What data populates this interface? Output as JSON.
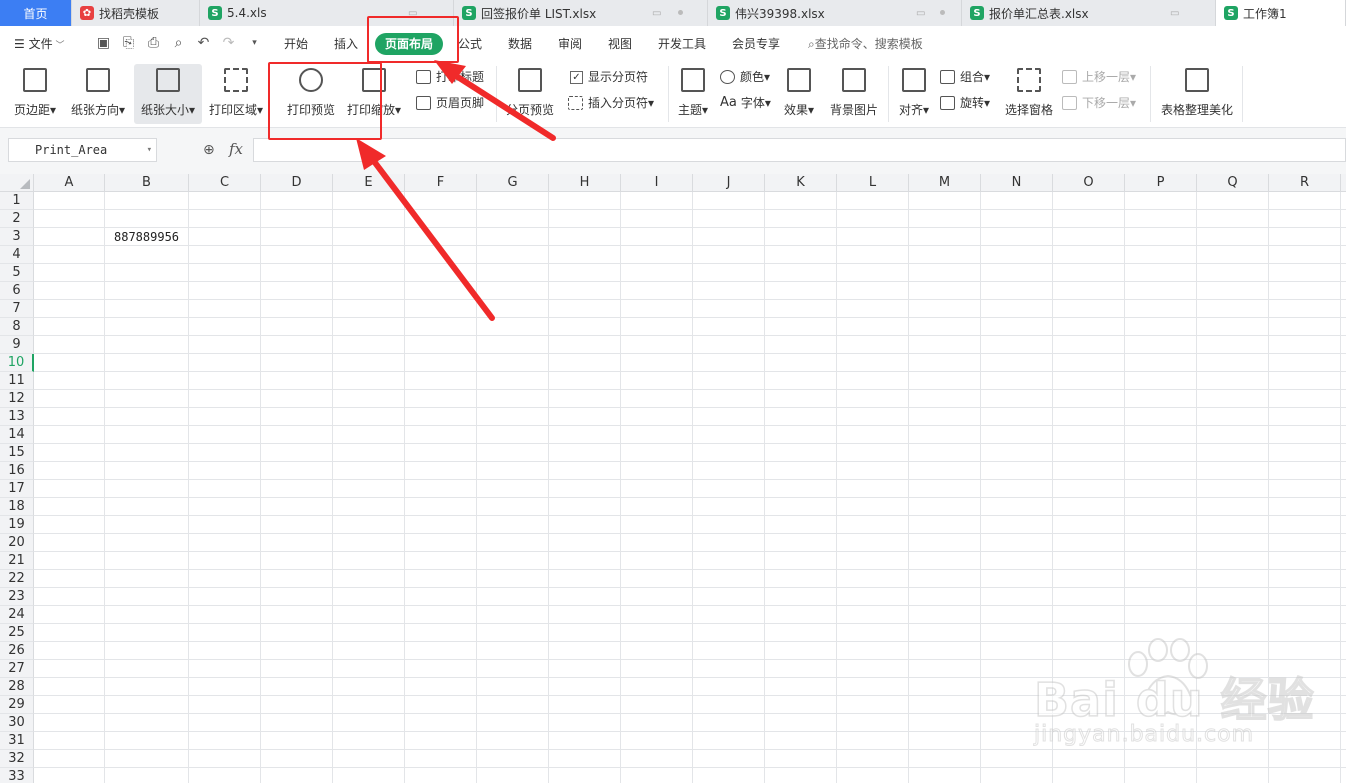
{
  "tabs": [
    {
      "label": "首页",
      "kind": "home"
    },
    {
      "label": "找稻壳模板",
      "kind": "r"
    },
    {
      "label": "5.4.xls",
      "kind": "s"
    },
    {
      "label": "回签报价单 LIST.xlsx",
      "kind": "s"
    },
    {
      "label": "伟兴39398.xlsx",
      "kind": "s"
    },
    {
      "label": "报价单汇总表.xlsx",
      "kind": "s"
    },
    {
      "label": "工作簿1",
      "kind": "s"
    }
  ],
  "file_icon_letter": "S",
  "menu": {
    "file": "文件",
    "items": [
      "开始",
      "插入",
      "页面布局",
      "公式",
      "数据",
      "审阅",
      "视图",
      "开发工具",
      "会员专享"
    ],
    "search": "查找命令、搜索模板"
  },
  "ribbon": {
    "margins": "页边距",
    "orientation": "纸张方向",
    "size": "纸张大小",
    "print_area": "打印区域",
    "print_preview": "打印预览",
    "print_scale": "打印缩放",
    "print_titles": "打印标题",
    "header_footer": "页眉页脚",
    "page_break_preview": "分页预览",
    "show_breaks": "显示分页符",
    "insert_break": "插入分页符",
    "theme": "主题",
    "colors": "颜色",
    "fonts": "字体",
    "fonts_prefix": "Aa",
    "effects": "效果",
    "background": "背景图片",
    "align": "对齐",
    "group": "组合",
    "rotate": "旋转",
    "select_pane": "选择窗格",
    "bring_forward": "上移一层",
    "send_backward": "下移一层",
    "beautify": "表格整理美化"
  },
  "formula_bar": {
    "name_box": "Print_Area",
    "fx": "fx",
    "value": ""
  },
  "columns": [
    "A",
    "B",
    "C",
    "D",
    "E",
    "F",
    "G",
    "H",
    "I",
    "J",
    "K",
    "L",
    "M",
    "N",
    "O",
    "P",
    "Q",
    "R"
  ],
  "rows": [
    "1",
    "2",
    "3",
    "4",
    "5",
    "6",
    "7",
    "8",
    "9",
    "10",
    "11",
    "12",
    "13",
    "14",
    "15",
    "16",
    "17",
    "18",
    "19",
    "20",
    "21",
    "22",
    "23",
    "24",
    "25",
    "26",
    "27",
    "28",
    "29",
    "30",
    "31",
    "32",
    "33"
  ],
  "active_row": "10",
  "cells": {
    "B3": "887889956"
  },
  "accent_color": "#1fa463",
  "annotation_color": "#f02a2a",
  "watermark": {
    "brand": "Bai  du 经验",
    "url": "jingyan.baidu.com"
  }
}
